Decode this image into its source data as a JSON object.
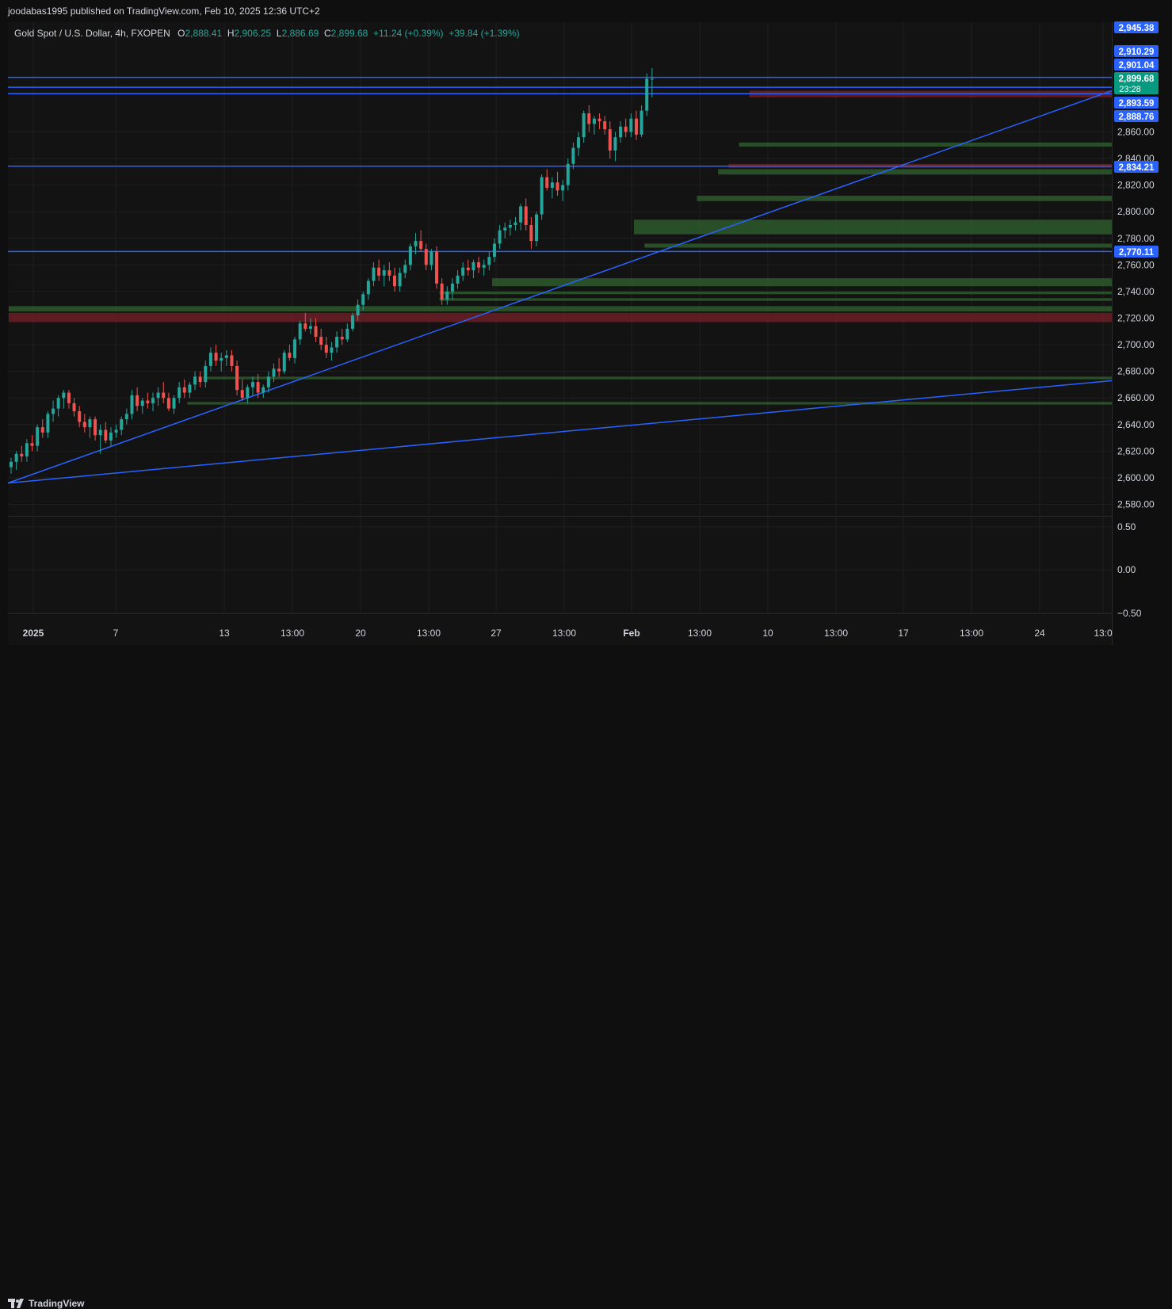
{
  "header": {
    "published_line": "joodabas1995 published on TradingView.com, Feb 10, 2025 12:36 UTC+2"
  },
  "legend": {
    "symbol": "Gold Spot / U.S. Dollar, 4h, FXOPEN",
    "o_label": "O",
    "o_value": "2,888.41",
    "h_label": "H",
    "h_value": "2,906.25",
    "l_label": "L",
    "l_value": "2,886.69",
    "c_label": "C",
    "c_value": "2,899.68",
    "change": "+11.24 (+0.39%)",
    "change2": "+39.84 (+1.39%)"
  },
  "footer": {
    "brand": "TradingView"
  },
  "colors": {
    "background": "#131313",
    "up": "#26a69a",
    "down": "#ef5350",
    "line": "#2962ff",
    "demand_zone": "#2e5a2e",
    "supply_zone": "#6b1f24",
    "grid": "#1f1f1f",
    "axis_text": "#d1d4dc"
  },
  "chart_data": {
    "type": "candlestick",
    "price_axis": {
      "ylim": [
        2570,
        2950
      ],
      "ticks": [
        "2,580.00",
        "2,600.00",
        "2,620.00",
        "2,640.00",
        "2,660.00",
        "2,680.00",
        "2,700.00",
        "2,720.00",
        "2,740.00",
        "2,760.00",
        "2,780.00",
        "2,800.00",
        "2,820.00",
        "2,840.00",
        "2,860.00"
      ]
    },
    "time_axis": {
      "labels": [
        "2025",
        "7",
        "13",
        "13:00",
        "20",
        "13:00",
        "27",
        "13:00",
        "Feb",
        "13:00",
        "10",
        "13:00",
        "17",
        "13:00",
        "24",
        "13:0"
      ]
    },
    "indicator_axis": {
      "ticks": [
        "0.50",
        "0.00",
        "−0.50"
      ]
    },
    "price_badges": [
      {
        "label": "2,945.38",
        "value": 2945.38,
        "kind": "line"
      },
      {
        "label": "2,910.29",
        "value": 2910.29,
        "kind": "line"
      },
      {
        "label": "2,901.04",
        "value": 2901.04,
        "kind": "line"
      },
      {
        "label": "2,899.68",
        "value": 2899.68,
        "kind": "current",
        "countdown": "23:28"
      },
      {
        "label": "2,893.59",
        "value": 2893.59,
        "kind": "line"
      },
      {
        "label": "2,888.76",
        "value": 2888.76,
        "kind": "line"
      },
      {
        "label": "2,834.21",
        "value": 2834.21,
        "kind": "line"
      },
      {
        "label": "2,770.11",
        "value": 2770.11,
        "kind": "line"
      }
    ],
    "horizontal_lines": [
      2901.04,
      2893.59,
      2888.76,
      2834.21,
      2770.11
    ],
    "trendlines": [
      {
        "from": [
          0,
          2596
        ],
        "to": [
          225,
          2891
        ]
      },
      {
        "from": [
          0,
          2596
        ],
        "to": [
          225,
          2673
        ]
      }
    ],
    "zones": [
      {
        "type": "supply",
        "from": 141,
        "low": 2886,
        "high": 2891
      },
      {
        "type": "demand",
        "from": 139,
        "low": 2849,
        "high": 2852
      },
      {
        "type": "supply",
        "from": 137,
        "low": 2833,
        "high": 2836
      },
      {
        "type": "demand",
        "from": 135,
        "low": 2828,
        "high": 2832
      },
      {
        "type": "demand",
        "from": 131,
        "low": 2808,
        "high": 2812
      },
      {
        "type": "demand",
        "from": 119,
        "low": 2783,
        "high": 2794
      },
      {
        "type": "demand",
        "from": 121,
        "low": 2773,
        "high": 2776
      },
      {
        "type": "demand",
        "from": 92,
        "low": 2744,
        "high": 2750
      },
      {
        "type": "demand",
        "from": 82,
        "low": 2738,
        "high": 2740
      },
      {
        "type": "demand",
        "from": 82,
        "low": 2733,
        "high": 2735
      },
      {
        "type": "demand",
        "from": 0,
        "low": 2725,
        "high": 2729
      },
      {
        "type": "supply",
        "from": 0,
        "low": 2717,
        "high": 2724
      },
      {
        "type": "demand",
        "from": 37,
        "low": 2674,
        "high": 2676
      },
      {
        "type": "demand",
        "from": 34,
        "low": 2655,
        "high": 2657
      }
    ],
    "candles": [
      [
        2608,
        2615,
        2603,
        2612
      ],
      [
        2612,
        2620,
        2606,
        2618
      ],
      [
        2618,
        2624,
        2612,
        2616
      ],
      [
        2616,
        2629,
        2612,
        2626
      ],
      [
        2626,
        2632,
        2620,
        2624
      ],
      [
        2624,
        2640,
        2620,
        2638
      ],
      [
        2638,
        2644,
        2630,
        2634
      ],
      [
        2634,
        2650,
        2630,
        2648
      ],
      [
        2648,
        2658,
        2642,
        2652
      ],
      [
        2652,
        2662,
        2646,
        2660
      ],
      [
        2660,
        2666,
        2652,
        2664
      ],
      [
        2664,
        2666,
        2652,
        2656
      ],
      [
        2656,
        2660,
        2646,
        2650
      ],
      [
        2650,
        2654,
        2638,
        2642
      ],
      [
        2642,
        2648,
        2634,
        2638
      ],
      [
        2638,
        2646,
        2630,
        2644
      ],
      [
        2644,
        2646,
        2628,
        2632
      ],
      [
        2632,
        2640,
        2618,
        2636
      ],
      [
        2636,
        2642,
        2626,
        2628
      ],
      [
        2628,
        2638,
        2624,
        2634
      ],
      [
        2634,
        2640,
        2630,
        2636
      ],
      [
        2636,
        2646,
        2632,
        2644
      ],
      [
        2644,
        2652,
        2640,
        2648
      ],
      [
        2648,
        2666,
        2644,
        2662
      ],
      [
        2662,
        2668,
        2650,
        2654
      ],
      [
        2654,
        2660,
        2648,
        2658
      ],
      [
        2658,
        2664,
        2652,
        2656
      ],
      [
        2656,
        2664,
        2650,
        2660
      ],
      [
        2660,
        2668,
        2654,
        2664
      ],
      [
        2664,
        2672,
        2656,
        2660
      ],
      [
        2660,
        2664,
        2650,
        2652
      ],
      [
        2652,
        2662,
        2648,
        2660
      ],
      [
        2660,
        2672,
        2656,
        2668
      ],
      [
        2668,
        2674,
        2660,
        2664
      ],
      [
        2664,
        2672,
        2660,
        2670
      ],
      [
        2670,
        2680,
        2666,
        2676
      ],
      [
        2676,
        2680,
        2668,
        2672
      ],
      [
        2672,
        2688,
        2668,
        2684
      ],
      [
        2684,
        2698,
        2680,
        2694
      ],
      [
        2694,
        2700,
        2684,
        2688
      ],
      [
        2688,
        2694,
        2680,
        2690
      ],
      [
        2690,
        2696,
        2684,
        2692
      ],
      [
        2692,
        2696,
        2680,
        2684
      ],
      [
        2684,
        2688,
        2662,
        2666
      ],
      [
        2666,
        2674,
        2658,
        2660
      ],
      [
        2660,
        2670,
        2656,
        2668
      ],
      [
        2668,
        2676,
        2662,
        2672
      ],
      [
        2672,
        2678,
        2660,
        2664
      ],
      [
        2664,
        2670,
        2660,
        2668
      ],
      [
        2668,
        2680,
        2664,
        2676
      ],
      [
        2676,
        2686,
        2672,
        2682
      ],
      [
        2682,
        2690,
        2676,
        2680
      ],
      [
        2680,
        2696,
        2678,
        2694
      ],
      [
        2694,
        2700,
        2688,
        2690
      ],
      [
        2690,
        2706,
        2686,
        2704
      ],
      [
        2704,
        2718,
        2700,
        2716
      ],
      [
        2716,
        2724,
        2710,
        2712
      ],
      [
        2712,
        2720,
        2708,
        2714
      ],
      [
        2714,
        2720,
        2702,
        2706
      ],
      [
        2706,
        2712,
        2696,
        2700
      ],
      [
        2700,
        2706,
        2690,
        2694
      ],
      [
        2694,
        2702,
        2688,
        2698
      ],
      [
        2698,
        2710,
        2694,
        2706
      ],
      [
        2706,
        2712,
        2700,
        2704
      ],
      [
        2704,
        2716,
        2702,
        2712
      ],
      [
        2712,
        2724,
        2710,
        2722
      ],
      [
        2722,
        2734,
        2718,
        2730
      ],
      [
        2730,
        2740,
        2726,
        2738
      ],
      [
        2738,
        2750,
        2734,
        2748
      ],
      [
        2748,
        2762,
        2744,
        2758
      ],
      [
        2758,
        2764,
        2748,
        2752
      ],
      [
        2752,
        2760,
        2744,
        2756
      ],
      [
        2756,
        2762,
        2748,
        2752
      ],
      [
        2752,
        2758,
        2740,
        2744
      ],
      [
        2744,
        2758,
        2740,
        2754
      ],
      [
        2754,
        2764,
        2750,
        2760
      ],
      [
        2760,
        2776,
        2756,
        2774
      ],
      [
        2774,
        2784,
        2768,
        2778
      ],
      [
        2778,
        2786,
        2770,
        2772
      ],
      [
        2772,
        2776,
        2756,
        2760
      ],
      [
        2760,
        2772,
        2756,
        2770
      ],
      [
        2770,
        2774,
        2742,
        2746
      ],
      [
        2746,
        2750,
        2730,
        2734
      ],
      [
        2734,
        2744,
        2730,
        2740
      ],
      [
        2740,
        2750,
        2734,
        2746
      ],
      [
        2746,
        2756,
        2742,
        2752
      ],
      [
        2752,
        2762,
        2748,
        2758
      ],
      [
        2758,
        2764,
        2752,
        2756
      ],
      [
        2756,
        2764,
        2750,
        2762
      ],
      [
        2762,
        2766,
        2754,
        2758
      ],
      [
        2758,
        2764,
        2752,
        2760
      ],
      [
        2760,
        2770,
        2756,
        2766
      ],
      [
        2766,
        2780,
        2762,
        2776
      ],
      [
        2776,
        2790,
        2772,
        2786
      ],
      [
        2786,
        2792,
        2780,
        2788
      ],
      [
        2788,
        2794,
        2782,
        2790
      ],
      [
        2790,
        2796,
        2786,
        2792
      ],
      [
        2792,
        2806,
        2786,
        2804
      ],
      [
        2804,
        2810,
        2786,
        2790
      ],
      [
        2790,
        2796,
        2772,
        2778
      ],
      [
        2778,
        2800,
        2774,
        2798
      ],
      [
        2798,
        2828,
        2794,
        2826
      ],
      [
        2826,
        2832,
        2816,
        2818
      ],
      [
        2818,
        2826,
        2810,
        2822
      ],
      [
        2822,
        2830,
        2812,
        2816
      ],
      [
        2816,
        2824,
        2808,
        2820
      ],
      [
        2820,
        2840,
        2816,
        2836
      ],
      [
        2836,
        2852,
        2832,
        2848
      ],
      [
        2848,
        2860,
        2842,
        2856
      ],
      [
        2856,
        2876,
        2852,
        2874
      ],
      [
        2874,
        2880,
        2860,
        2866
      ],
      [
        2866,
        2872,
        2858,
        2870
      ],
      [
        2870,
        2874,
        2862,
        2868
      ],
      [
        2868,
        2872,
        2858,
        2862
      ],
      [
        2862,
        2868,
        2840,
        2846
      ],
      [
        2846,
        2860,
        2838,
        2856
      ],
      [
        2856,
        2868,
        2852,
        2864
      ],
      [
        2864,
        2870,
        2856,
        2860
      ],
      [
        2860,
        2874,
        2856,
        2870
      ],
      [
        2870,
        2876,
        2854,
        2858
      ],
      [
        2858,
        2880,
        2856,
        2876
      ],
      [
        2876,
        2904,
        2872,
        2900
      ],
      [
        2900,
        2908,
        2886,
        2900
      ]
    ]
  }
}
